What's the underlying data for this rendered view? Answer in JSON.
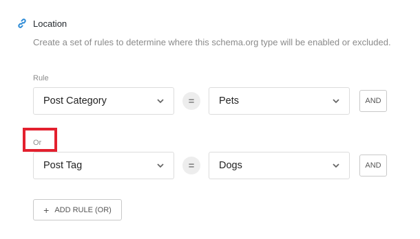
{
  "section": {
    "title": "Location",
    "description": "Create a set of rules to determine where this schema.org type will be enabled or excluded."
  },
  "rules": [
    {
      "group_label": "Rule",
      "field": "Post Category",
      "operator": "=",
      "value": "Pets",
      "and_label": "AND"
    },
    {
      "group_label": "Or",
      "field": "Post Tag",
      "operator": "=",
      "value": "Dogs",
      "and_label": "AND"
    }
  ],
  "add_rule": {
    "label": "ADD RULE (OR)",
    "icon": "plus-icon"
  },
  "colors": {
    "accent": "#2d8bd6",
    "highlight": "#e3202e",
    "border": "#dcdcdc",
    "muted_text": "#8c8c8c"
  }
}
